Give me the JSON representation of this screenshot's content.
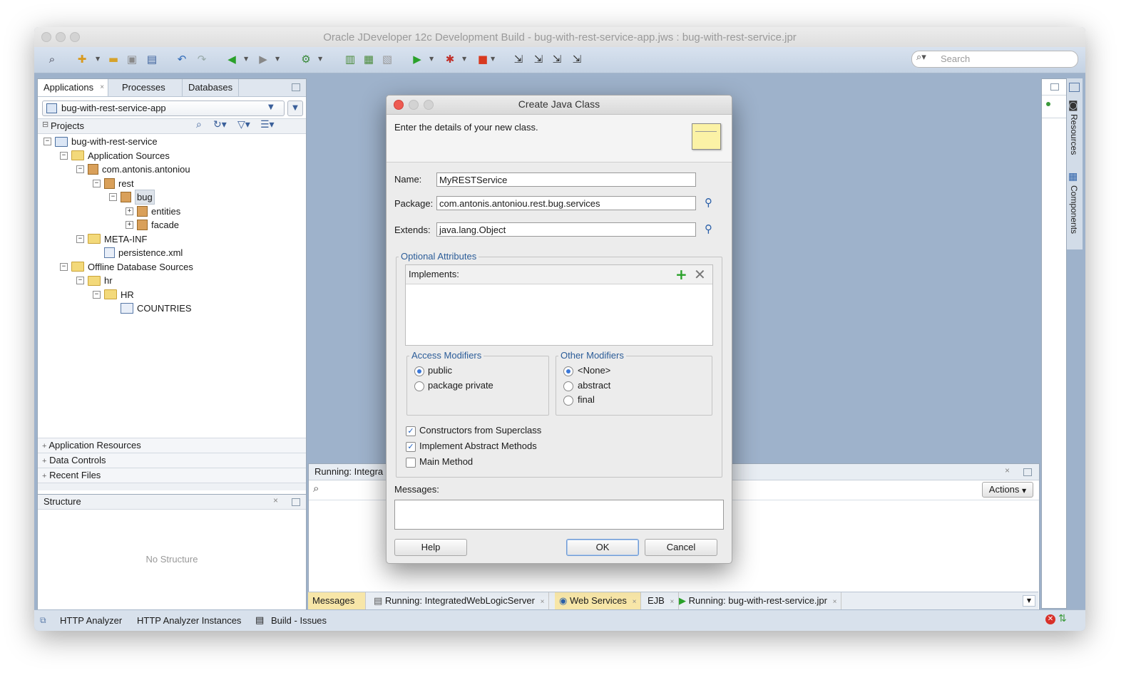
{
  "window": {
    "title": "Oracle JDeveloper 12c Development Build - bug-with-rest-service-app.jws : bug-with-rest-service.jpr"
  },
  "toolbar": {
    "search_placeholder": "Search"
  },
  "left_panel": {
    "tabs": [
      {
        "label": "Applications",
        "active": true
      },
      {
        "label": "Processes"
      },
      {
        "label": "Databases"
      }
    ],
    "app_selector": "bug-with-rest-service-app",
    "projects_label": "Projects",
    "tree": [
      {
        "label": "bug-with-rest-service",
        "indent": 0,
        "type": "project",
        "exp": "−"
      },
      {
        "label": "Application Sources",
        "indent": 1,
        "type": "folder",
        "exp": "−"
      },
      {
        "label": "com.antonis.antoniou",
        "indent": 2,
        "type": "package",
        "exp": "−"
      },
      {
        "label": "rest",
        "indent": 3,
        "type": "package",
        "exp": "−"
      },
      {
        "label": "bug",
        "indent": 4,
        "type": "package",
        "exp": "−",
        "selected": true
      },
      {
        "label": "entities",
        "indent": 5,
        "type": "package",
        "exp": "+"
      },
      {
        "label": "facade",
        "indent": 5,
        "type": "package",
        "exp": "+"
      },
      {
        "label": "META-INF",
        "indent": 2,
        "type": "folder",
        "exp": "−"
      },
      {
        "label": "persistence.xml",
        "indent": 3,
        "type": "file",
        "exp": ""
      },
      {
        "label": "Offline Database Sources",
        "indent": 1,
        "type": "folder",
        "exp": "−"
      },
      {
        "label": "hr",
        "indent": 2,
        "type": "folder",
        "exp": "−"
      },
      {
        "label": "HR",
        "indent": 3,
        "type": "folder",
        "exp": "−"
      },
      {
        "label": "COUNTRIES",
        "indent": 4,
        "type": "table",
        "exp": ""
      }
    ],
    "accordions": [
      "Application Resources",
      "Data Controls",
      "Recent Files"
    ]
  },
  "structure": {
    "title": "Structure",
    "empty_text": "No Structure"
  },
  "right_strip": {
    "resources_label": "Resources",
    "components_label": "Components"
  },
  "log_panel": {
    "title": "Running: Integra",
    "actions_label": "Actions"
  },
  "bottom_tabs": [
    "Messages",
    "Running: IntegratedWebLogicServer",
    "Web Services",
    "EJB",
    "Running: bug-with-rest-service.jpr"
  ],
  "status_bar": {
    "items": [
      "HTTP Analyzer",
      "HTTP Analyzer Instances",
      "Build - Issues"
    ]
  },
  "dialog": {
    "title": "Create Java Class",
    "instructions": "Enter the details of your new class.",
    "name_label": "Name:",
    "name_value": "MyRESTService",
    "package_label": "Package:",
    "package_value": "com.antonis.antoniou.rest.bug.services",
    "extends_label": "Extends:",
    "extends_value": "java.lang.Object",
    "optional_label": "Optional Attributes",
    "implements_label": "Implements:",
    "access_label": "Access Modifiers",
    "access_options": [
      {
        "label": "public",
        "selected": true
      },
      {
        "label": "package private",
        "selected": false
      }
    ],
    "other_label": "Other Modifiers",
    "other_options": [
      {
        "label": "<None>",
        "selected": true
      },
      {
        "label": "abstract",
        "selected": false
      },
      {
        "label": "final",
        "selected": false
      }
    ],
    "checkboxes": [
      {
        "label": "Constructors from Superclass",
        "checked": true
      },
      {
        "label": "Implement Abstract Methods",
        "checked": true
      },
      {
        "label": "Main Method",
        "checked": false
      }
    ],
    "messages_label": "Messages:",
    "help_label": "Help",
    "ok_label": "OK",
    "cancel_label": "Cancel"
  }
}
